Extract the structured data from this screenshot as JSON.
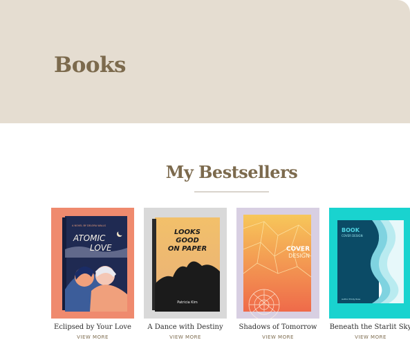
{
  "hero": {
    "title": "Books"
  },
  "section": {
    "title": "My Bestsellers"
  },
  "books": [
    {
      "title": "Eclipsed by Your Love",
      "link": "VIEW MORE",
      "cover_kicker": "A NOVEL BY DELORA WALLS",
      "cover_title_1": "ATOMIC",
      "cover_title_2": "LOVE",
      "bg": "#ef8a6e"
    },
    {
      "title": "A Dance with Destiny",
      "link": "VIEW MORE",
      "cover_title_1": "LOOKS",
      "cover_title_2": "GOOD",
      "cover_title_3": "ON PAPER",
      "cover_author": "Patricia Kim",
      "bg": "#d9d9d9"
    },
    {
      "title": "Shadows of Tomorrow",
      "link": "VIEW MORE",
      "cover_title_1": "COVER",
      "cover_title_2": "DESIGN",
      "bg": "#d8cfe2"
    },
    {
      "title": "Beneath the Starlit Sky",
      "link": "VIEW MORE",
      "cover_title_1": "BOOK",
      "cover_title_2": "COVER DESIGN",
      "cover_author": "Author Emily Ross",
      "bg": "#19d3cf"
    }
  ]
}
